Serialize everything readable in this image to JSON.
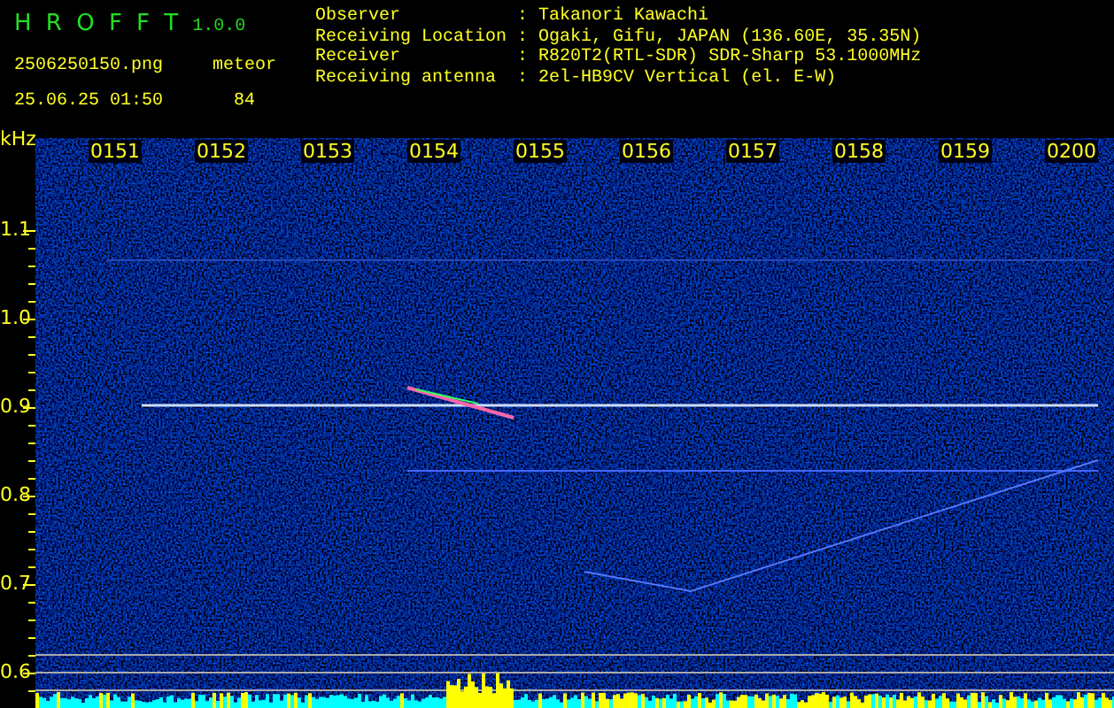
{
  "header": {
    "title": "H R O F F T",
    "version": "1.0.0",
    "filename": "2506250150.png",
    "datetime": "25.06.25 01:50",
    "counter_label": "meteor",
    "counter_value": "84",
    "info": [
      {
        "label": "Observer",
        "separator": ":",
        "value": "Takanori Kawachi"
      },
      {
        "label": "Receiving Location",
        "separator": ":",
        "value": "Ogaki, Gifu, JAPAN (136.60E, 35.35N)"
      },
      {
        "label": "Receiver",
        "separator": ":",
        "value": "R820T2(RTL-SDR) SDR-Sharp 53.1000MHz"
      },
      {
        "label": "Receiving antenna",
        "separator": ":",
        "value": "2el-HB9CV Vertical (el. E-W)"
      }
    ]
  },
  "plot": {
    "unit": "kHz",
    "time_labels": [
      "0151",
      "0152",
      "0153",
      "0154",
      "0155",
      "0156",
      "0157",
      "0158",
      "0159",
      "0200"
    ],
    "freq_labels": [
      "1.1",
      "1.0",
      "0.9",
      "0.8",
      "0.7",
      "0.6"
    ]
  }
}
